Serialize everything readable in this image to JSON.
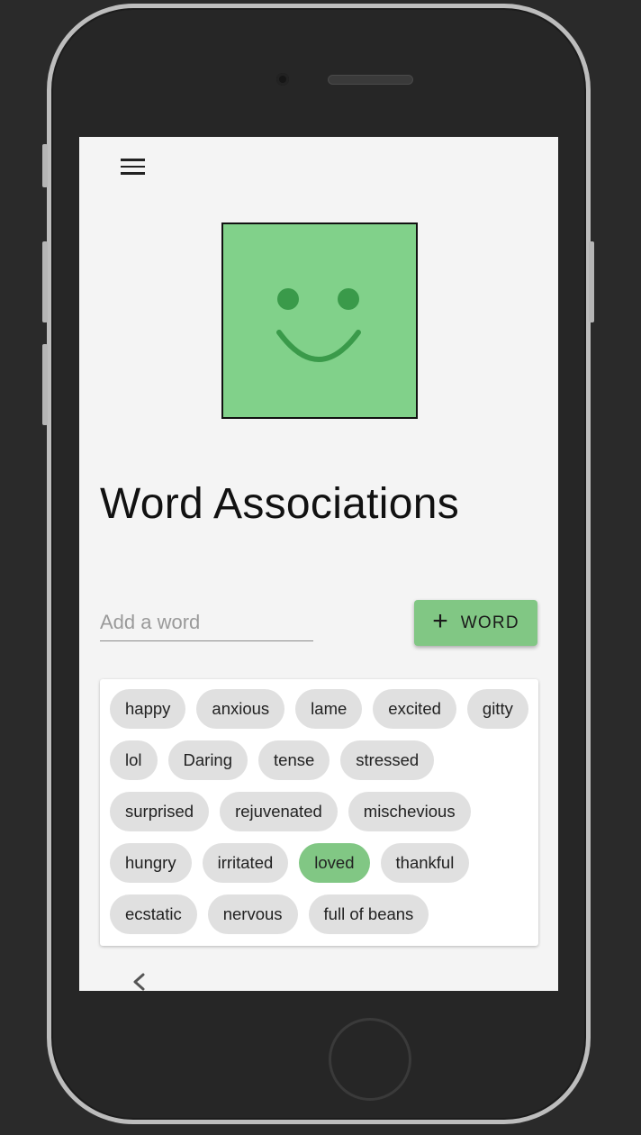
{
  "header": {
    "title": "Word Associations"
  },
  "input": {
    "placeholder": "Add a word"
  },
  "add_button": {
    "label": "WORD",
    "color": "#81c784"
  },
  "mood": {
    "face": "smile",
    "color": "#81d18a"
  },
  "chips": [
    {
      "label": "happy",
      "selected": false
    },
    {
      "label": "anxious",
      "selected": false
    },
    {
      "label": "lame",
      "selected": false
    },
    {
      "label": "excited",
      "selected": false
    },
    {
      "label": "gitty",
      "selected": false
    },
    {
      "label": "lol",
      "selected": false
    },
    {
      "label": "Daring",
      "selected": false
    },
    {
      "label": "tense",
      "selected": false
    },
    {
      "label": "stressed",
      "selected": false
    },
    {
      "label": "surprised",
      "selected": false
    },
    {
      "label": "rejuvenated",
      "selected": false
    },
    {
      "label": "mischevious",
      "selected": false
    },
    {
      "label": "hungry",
      "selected": false
    },
    {
      "label": "irritated",
      "selected": false
    },
    {
      "label": "loved",
      "selected": true
    },
    {
      "label": "thankful",
      "selected": false
    },
    {
      "label": "ecstatic",
      "selected": false
    },
    {
      "label": "nervous",
      "selected": false
    },
    {
      "label": "full of beans",
      "selected": false
    }
  ],
  "icons": {
    "menu": "hamburger-menu-icon",
    "add": "plus-icon",
    "back": "chevron-left-icon"
  }
}
